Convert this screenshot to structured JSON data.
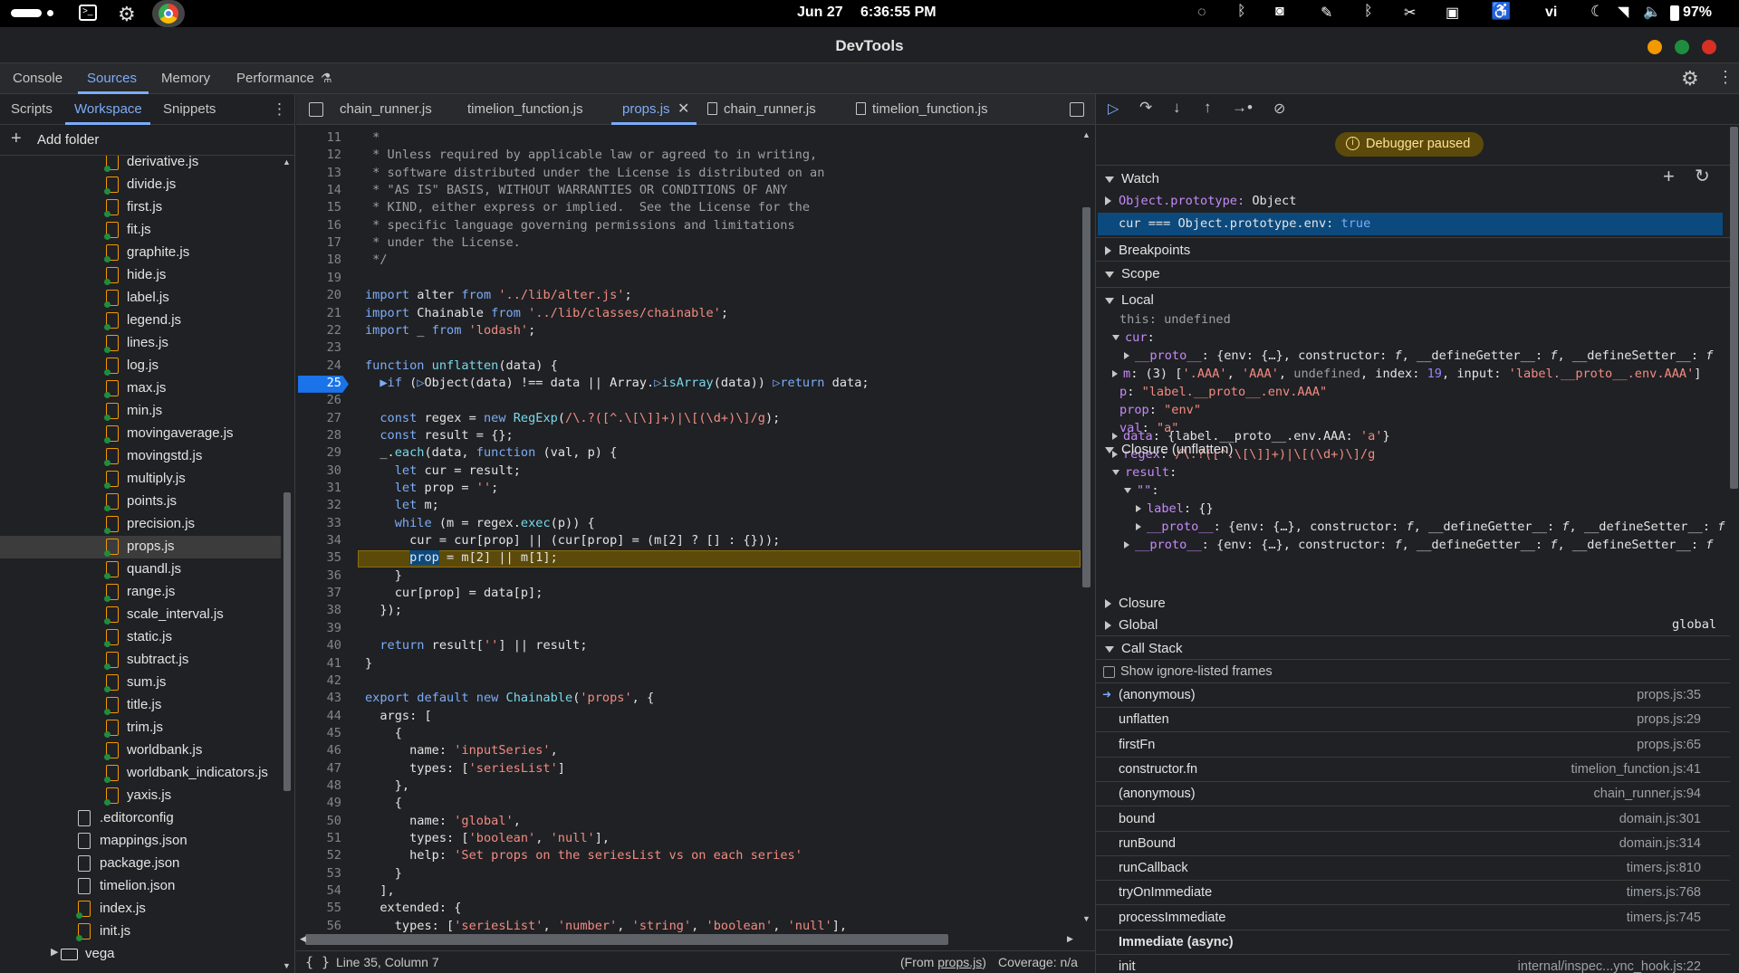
{
  "system": {
    "date": "Jun 27",
    "time": "6:36:55 PM",
    "lang": "vi",
    "battery": "97%"
  },
  "window": {
    "title": "DevTools"
  },
  "top_tabs": [
    {
      "label": "Console"
    },
    {
      "label": "Sources"
    },
    {
      "label": "Memory"
    },
    {
      "label": "Performance"
    }
  ],
  "navigator": {
    "tabs": [
      {
        "label": "Scripts"
      },
      {
        "label": "Workspace"
      },
      {
        "label": "Snippets"
      }
    ],
    "add_folder": "Add folder",
    "files": [
      "derivative.js",
      "divide.js",
      "first.js",
      "fit.js",
      "graphite.js",
      "hide.js",
      "label.js",
      "legend.js",
      "lines.js",
      "log.js",
      "max.js",
      "min.js",
      "movingaverage.js",
      "movingstd.js",
      "multiply.js",
      "points.js",
      "precision.js",
      "props.js",
      "quandl.js",
      "range.js",
      "scale_interval.js",
      "static.js",
      "subtract.js",
      "sum.js",
      "title.js",
      "trim.js",
      "worldbank.js",
      "worldbank_indicators.js",
      "yaxis.js"
    ],
    "root_files": [
      ".editorconfig",
      "mappings.json",
      "package.json",
      "timelion.json",
      "index.js",
      "init.js"
    ],
    "folder": "vega"
  },
  "editor": {
    "tabs": [
      "chain_runner.js",
      "timelion_function.js",
      "props.js",
      "chain_runner.js",
      "timelion_function.js"
    ],
    "status": "Line 35, Column 7",
    "from_prefix": "(From ",
    "from_file": "props.js",
    "from_suffix": ")",
    "coverage": "Coverage: n/a"
  },
  "debugger": {
    "paused": "Debugger paused",
    "watch": "Watch",
    "watch_items": [
      {
        "expr": "Object.prototype:",
        "val": " Object"
      },
      {
        "expr": "cur === Object.prototype.env:",
        "val": " true"
      }
    ],
    "breakpoints": "Breakpoints",
    "scope": "Scope",
    "local": "Local",
    "closure_unflatten": "Closure (unflatten)",
    "closure": "Closure",
    "global": "Global",
    "global_val": "global",
    "call_stack": "Call Stack",
    "show_ignore": "Show ignore-listed frames",
    "frames": [
      {
        "fn": "(anonymous)",
        "loc": "props.js:35"
      },
      {
        "fn": "unflatten",
        "loc": "props.js:29"
      },
      {
        "fn": "firstFn",
        "loc": "props.js:65"
      },
      {
        "fn": "constructor.fn",
        "loc": "timelion_function.js:41"
      },
      {
        "fn": "(anonymous)",
        "loc": "chain_runner.js:94"
      },
      {
        "fn": "bound",
        "loc": "domain.js:301"
      },
      {
        "fn": "runBound",
        "loc": "domain.js:314"
      },
      {
        "fn": "runCallback",
        "loc": "timers.js:810"
      },
      {
        "fn": "tryOnImmediate",
        "loc": "timers.js:768"
      },
      {
        "fn": "processImmediate",
        "loc": "timers.js:745"
      }
    ],
    "async_label": "Immediate (async)",
    "last_frame": {
      "fn": "init",
      "loc": "internal/inspec...ync_hook.js:22"
    }
  }
}
